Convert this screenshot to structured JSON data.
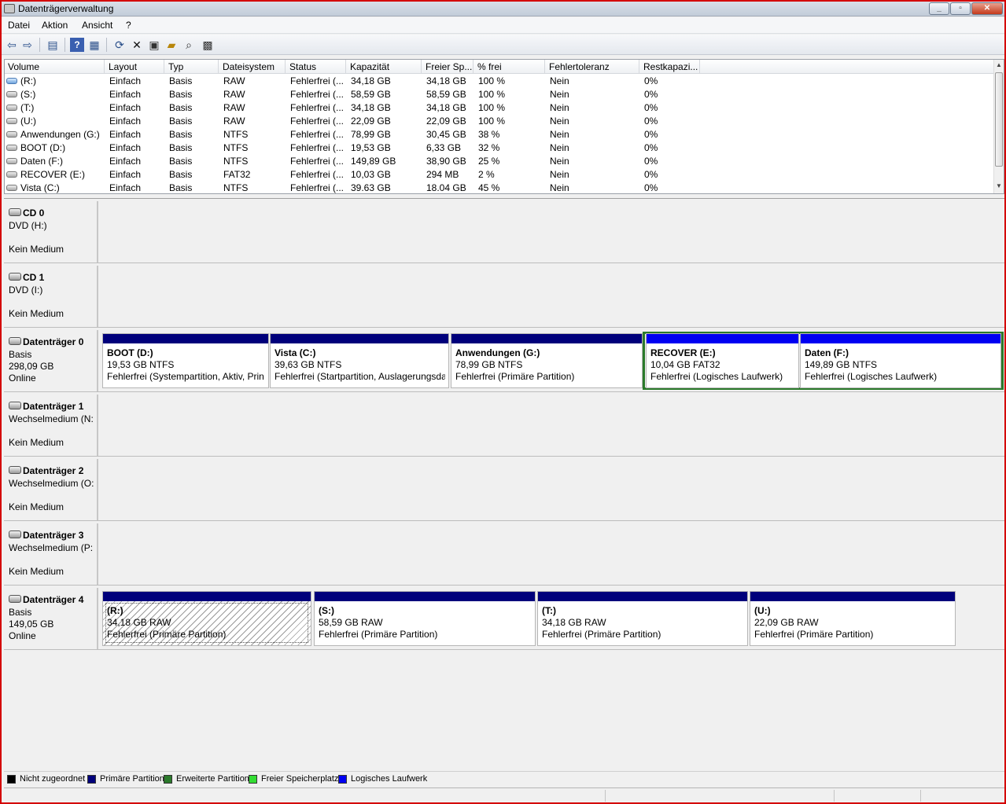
{
  "window": {
    "title": "Datenträgerverwaltung"
  },
  "menu": [
    "Datei",
    "Aktion",
    "Ansicht",
    "?"
  ],
  "toolbar": [
    "back-icon",
    "forward-icon",
    "console-tree-icon",
    "help-icon",
    "properties-view-icon",
    "refresh-icon",
    "delete-icon",
    "properties-icon",
    "open-icon",
    "explore-icon",
    "settings-icon"
  ],
  "volume_list": {
    "columns": [
      "Volume",
      "Layout",
      "Typ",
      "Dateisystem",
      "Status",
      "Kapazität",
      "Freier Sp...",
      "% frei",
      "Fehlertoleranz",
      "Restkapazi..."
    ],
    "rows": [
      {
        "volume": "(R:)",
        "layout": "Einfach",
        "typ": "Basis",
        "fs": "RAW",
        "status": "Fehlerfrei (...",
        "cap": "34,18 GB",
        "free": "34,18 GB",
        "pct": "100 %",
        "ft": "Nein",
        "rest": "0%",
        "icon": "blue"
      },
      {
        "volume": "(S:)",
        "layout": "Einfach",
        "typ": "Basis",
        "fs": "RAW",
        "status": "Fehlerfrei (...",
        "cap": "58,59 GB",
        "free": "58,59 GB",
        "pct": "100 %",
        "ft": "Nein",
        "rest": "0%",
        "icon": "gray"
      },
      {
        "volume": "(T:)",
        "layout": "Einfach",
        "typ": "Basis",
        "fs": "RAW",
        "status": "Fehlerfrei (...",
        "cap": "34,18 GB",
        "free": "34,18 GB",
        "pct": "100 %",
        "ft": "Nein",
        "rest": "0%",
        "icon": "gray"
      },
      {
        "volume": "(U:)",
        "layout": "Einfach",
        "typ": "Basis",
        "fs": "RAW",
        "status": "Fehlerfrei (...",
        "cap": "22,09 GB",
        "free": "22,09 GB",
        "pct": "100 %",
        "ft": "Nein",
        "rest": "0%",
        "icon": "gray"
      },
      {
        "volume": "Anwendungen (G:)",
        "layout": "Einfach",
        "typ": "Basis",
        "fs": "NTFS",
        "status": "Fehlerfrei (...",
        "cap": "78,99 GB",
        "free": "30,45 GB",
        "pct": "38 %",
        "ft": "Nein",
        "rest": "0%",
        "icon": "gray"
      },
      {
        "volume": "BOOT (D:)",
        "layout": "Einfach",
        "typ": "Basis",
        "fs": "NTFS",
        "status": "Fehlerfrei (...",
        "cap": "19,53 GB",
        "free": "6,33 GB",
        "pct": "32 %",
        "ft": "Nein",
        "rest": "0%",
        "icon": "gray"
      },
      {
        "volume": "Daten (F:)",
        "layout": "Einfach",
        "typ": "Basis",
        "fs": "NTFS",
        "status": "Fehlerfrei (...",
        "cap": "149,89 GB",
        "free": "38,90 GB",
        "pct": "25 %",
        "ft": "Nein",
        "rest": "0%",
        "icon": "gray"
      },
      {
        "volume": "RECOVER (E:)",
        "layout": "Einfach",
        "typ": "Basis",
        "fs": "FAT32",
        "status": "Fehlerfrei (...",
        "cap": "10,03 GB",
        "free": "294 MB",
        "pct": "2 %",
        "ft": "Nein",
        "rest": "0%",
        "icon": "gray"
      },
      {
        "volume": "Vista (C:)",
        "layout": "Einfach",
        "typ": "Basis",
        "fs": "NTFS",
        "status": "Fehlerfrei (...",
        "cap": "39.63 GB",
        "free": "18.04 GB",
        "pct": "45 %",
        "ft": "Nein",
        "rest": "0%",
        "icon": "gray"
      }
    ]
  },
  "disks": [
    {
      "name": "CD 0",
      "lines": [
        "DVD (H:)",
        "",
        "Kein Medium"
      ],
      "partitions": []
    },
    {
      "name": "CD 1",
      "lines": [
        "DVD (I:)",
        "",
        "Kein Medium"
      ],
      "partitions": []
    },
    {
      "name": "Datenträger 0",
      "lines": [
        "Basis",
        "298,09 GB",
        "Online"
      ],
      "partitions": [
        {
          "name": "BOOT  (D:)",
          "size": "19,53 GB NTFS",
          "status": "Fehlerfrei (Systempartition, Aktiv, Prin",
          "kind": "primary"
        },
        {
          "name": "Vista  (C:)",
          "size": "39,63 GB NTFS",
          "status": "Fehlerfrei (Startpartition, Auslagerungsda",
          "kind": "primary"
        },
        {
          "name": "Anwendungen  (G:)",
          "size": "78,99 GB NTFS",
          "status": "Fehlerfrei (Primäre Partition)",
          "kind": "primary"
        },
        {
          "name": "RECOVER  (E:)",
          "size": "10,04 GB FAT32",
          "status": "Fehlerfrei (Logisches Laufwerk)",
          "kind": "logical"
        },
        {
          "name": "Daten  (F:)",
          "size": "149,89 GB NTFS",
          "status": "Fehlerfrei (Logisches Laufwerk)",
          "kind": "logical"
        }
      ]
    },
    {
      "name": "Datenträger 1",
      "lines": [
        "Wechselmedium (N:",
        "",
        "Kein Medium"
      ],
      "partitions": []
    },
    {
      "name": "Datenträger 2",
      "lines": [
        "Wechselmedium (O:",
        "",
        "Kein Medium"
      ],
      "partitions": []
    },
    {
      "name": "Datenträger 3",
      "lines": [
        "Wechselmedium (P:",
        "",
        "Kein Medium"
      ],
      "partitions": []
    },
    {
      "name": "Datenträger 4",
      "lines": [
        "Basis",
        "149,05 GB",
        "Online"
      ],
      "partitions": [
        {
          "name": "(R:)",
          "size": "34,18 GB RAW",
          "status": "Fehlerfrei (Primäre Partition)",
          "kind": "primary",
          "selected": true
        },
        {
          "name": "(S:)",
          "size": "58,59 GB RAW",
          "status": "Fehlerfrei (Primäre Partition)",
          "kind": "primary"
        },
        {
          "name": "(T:)",
          "size": "34,18 GB RAW",
          "status": "Fehlerfrei (Primäre Partition)",
          "kind": "primary"
        },
        {
          "name": "(U:)",
          "size": "22,09 GB RAW",
          "status": "Fehlerfrei (Primäre Partition)",
          "kind": "primary"
        }
      ]
    }
  ],
  "legend": [
    {
      "label": "Nicht zugeordnet",
      "color": "#000000"
    },
    {
      "label": "Primäre Partition",
      "color": "#00007b"
    },
    {
      "label": "Erweiterte Partition",
      "color": "#2b7a2b"
    },
    {
      "label": "Freier Speicherplatz",
      "color": "#33dd33"
    },
    {
      "label": "Logisches Laufwerk",
      "color": "#0000f2"
    }
  ]
}
